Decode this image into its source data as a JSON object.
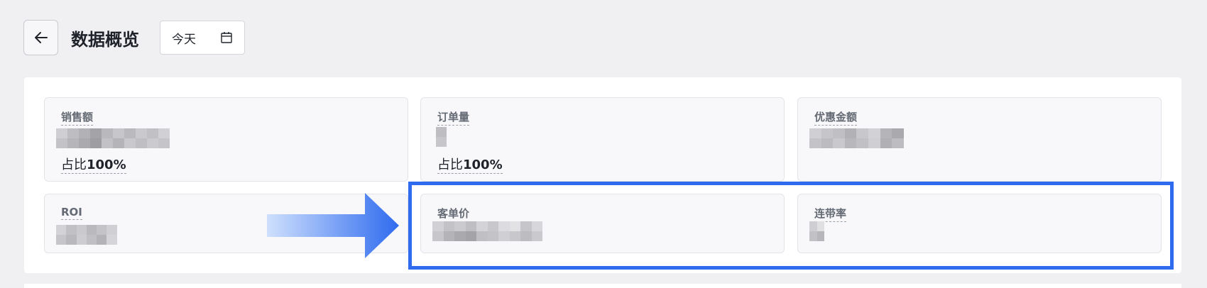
{
  "header": {
    "title": "数据概览",
    "date_value": "今天"
  },
  "icons": {
    "back": "arrow-left-icon",
    "calendar": "calendar-icon"
  },
  "colors": {
    "highlight": "#2f6bef",
    "arrow_start": "#cfe0fd",
    "arrow_end": "#2f6bef"
  },
  "metrics": {
    "sales": {
      "label": "销售额",
      "ratio_prefix": "占比",
      "ratio_value": "100%"
    },
    "orders": {
      "label": "订单量",
      "ratio_prefix": "占比",
      "ratio_value": "100%"
    },
    "discount": {
      "label": "优惠金额"
    },
    "roi": {
      "label": "ROI"
    },
    "avg_order_value": {
      "label": "客单价"
    },
    "attach_rate": {
      "label": "连带率"
    }
  }
}
